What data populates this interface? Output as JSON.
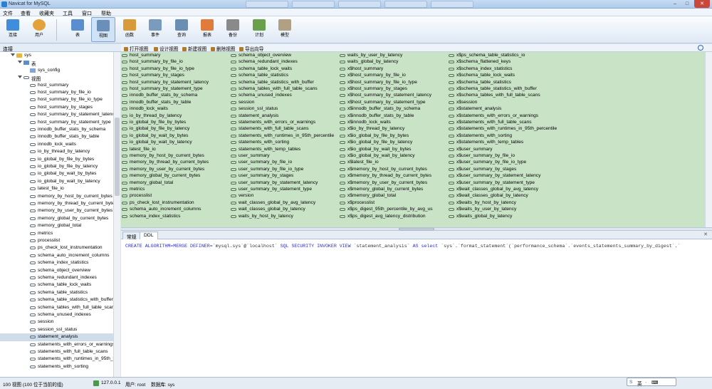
{
  "window": {
    "title": "Navicat for MySQL"
  },
  "menu": [
    "文件",
    "查看",
    "收藏夹",
    "工具",
    "窗口",
    "帮助"
  ],
  "toolbar": [
    {
      "label": "连接",
      "icon": "plug-icon",
      "color": "#3f8ddb"
    },
    {
      "label": "用户",
      "icon": "user-icon",
      "color": "#e4a23a"
    },
    {
      "label": "表",
      "icon": "table-icon",
      "color": "#5b8ecf"
    },
    {
      "label": "视图",
      "icon": "view-icon",
      "color": "#6a8fb8"
    },
    {
      "label": "函数",
      "icon": "function-icon",
      "color": "#d99b3a"
    },
    {
      "label": "事件",
      "icon": "event-icon",
      "color": "#7a9bbd"
    },
    {
      "label": "查询",
      "icon": "query-icon",
      "color": "#6b8fb3"
    },
    {
      "label": "报表",
      "icon": "report-icon",
      "color": "#e07b3c"
    },
    {
      "label": "备份",
      "icon": "backup-icon",
      "color": "#8a8a8a"
    },
    {
      "label": "计划",
      "icon": "schedule-icon",
      "color": "#6aa04c"
    },
    {
      "label": "模型",
      "icon": "model-icon",
      "color": "#b0a184"
    }
  ],
  "left_panel": {
    "title": "连接",
    "tree_top": [
      {
        "label": "sys",
        "level": 0,
        "kind": "db"
      },
      {
        "label": "表",
        "level": 1,
        "kind": "folder"
      },
      {
        "label": "sys_config",
        "level": 2,
        "kind": "table"
      },
      {
        "label": "视图",
        "level": 1,
        "kind": "folder"
      }
    ],
    "views": [
      "host_summary",
      "host_summary_by_file_io",
      "host_summary_by_file_io_type",
      "host_summary_by_stages",
      "host_summary_by_statement_latency",
      "host_summary_by_statement_type",
      "innodb_buffer_stats_by_schema",
      "innodb_buffer_stats_by_table",
      "innodb_lock_waits",
      "io_by_thread_by_latency",
      "io_global_by_file_by_bytes",
      "io_global_by_file_by_latency",
      "io_global_by_wait_by_bytes",
      "io_global_by_wait_by_latency",
      "latest_file_io",
      "memory_by_host_by_current_bytes",
      "memory_by_thread_by_current_bytes",
      "memory_by_user_by_current_bytes",
      "memory_global_by_current_bytes",
      "memory_global_total",
      "metrics",
      "processlist",
      "ps_check_lost_instrumentation",
      "schema_auto_increment_columns",
      "schema_index_statistics",
      "schema_object_overview",
      "schema_redundant_indexes",
      "schema_table_lock_waits",
      "schema_table_statistics",
      "schema_table_statistics_with_buffer",
      "schema_tables_with_full_table_scans",
      "schema_unused_indexes",
      "session",
      "session_ssl_status",
      "statement_analysis",
      "statements_with_errors_or_warnings",
      "statements_with_full_table_scans",
      "statements_with_runtimes_in_95th_percentile",
      "statements_with_sorting"
    ],
    "selected": "statement_analysis"
  },
  "object_toolbar": [
    "打开视图",
    "设计视图",
    "新建视图",
    "删除视图",
    "导出向导"
  ],
  "object_columns": [
    [
      "host_summary",
      "host_summary_by_file_io",
      "host_summary_by_file_io_type",
      "host_summary_by_stages",
      "host_summary_by_statement_latency",
      "host_summary_by_statement_type",
      "innodb_buffer_stats_by_schema",
      "innodb_buffer_stats_by_table",
      "innodb_lock_waits",
      "io_by_thread_by_latency",
      "io_global_by_file_by_bytes",
      "io_global_by_file_by_latency",
      "io_global_by_wait_by_bytes",
      "io_global_by_wait_by_latency",
      "latest_file_io",
      "memory_by_host_by_current_bytes",
      "memory_by_thread_by_current_bytes",
      "memory_by_user_by_current_bytes",
      "memory_global_by_current_bytes",
      "memory_global_total",
      "metrics",
      "processlist",
      "ps_check_lost_instrumentation",
      "schema_auto_increment_columns",
      "schema_index_statistics"
    ],
    [
      "schema_object_overview",
      "schema_redundant_indexes",
      "schema_table_lock_waits",
      "schema_table_statistics",
      "schema_table_statistics_with_buffer",
      "schema_tables_with_full_table_scans",
      "schema_unused_indexes",
      "session",
      "session_ssl_status",
      "statement_analysis",
      "statements_with_errors_or_warnings",
      "statements_with_full_table_scans",
      "statements_with_runtimes_in_95th_percentile",
      "statements_with_sorting",
      "statements_with_temp_tables",
      "user_summary",
      "user_summary_by_file_io",
      "user_summary_by_file_io_type",
      "user_summary_by_stages",
      "user_summary_by_statement_latency",
      "user_summary_by_statement_type",
      "version",
      "wait_classes_global_by_avg_latency",
      "wait_classes_global_by_latency",
      "waits_by_host_by_latency"
    ],
    [
      "waits_by_user_by_latency",
      "waits_global_by_latency",
      "x$host_summary",
      "x$host_summary_by_file_io",
      "x$host_summary_by_file_io_type",
      "x$host_summary_by_stages",
      "x$host_summary_by_statement_latency",
      "x$host_summary_by_statement_type",
      "x$innodb_buffer_stats_by_schema",
      "x$innodb_buffer_stats_by_table",
      "x$innodb_lock_waits",
      "x$io_by_thread_by_latency",
      "x$io_global_by_file_by_bytes",
      "x$io_global_by_file_by_latency",
      "x$io_global_by_wait_by_bytes",
      "x$io_global_by_wait_by_latency",
      "x$latest_file_io",
      "x$memory_by_host_by_current_bytes",
      "x$memory_by_thread_by_current_bytes",
      "x$memory_by_user_by_current_bytes",
      "x$memory_global_by_current_bytes",
      "x$memory_global_total",
      "x$processlist",
      "x$ps_digest_95th_percentile_by_avg_us",
      "x$ps_digest_avg_latency_distribution"
    ],
    [
      "x$ps_schema_table_statistics_io",
      "x$schema_flattened_keys",
      "x$schema_index_statistics",
      "x$schema_table_lock_waits",
      "x$schema_table_statistics",
      "x$schema_table_statistics_with_buffer",
      "x$schema_tables_with_full_table_scans",
      "x$session",
      "x$statement_analysis",
      "x$statements_with_errors_or_warnings",
      "x$statements_with_full_table_scans",
      "x$statements_with_runtimes_in_95th_percentile",
      "x$statements_with_sorting",
      "x$statements_with_temp_tables",
      "x$user_summary",
      "x$user_summary_by_file_io",
      "x$user_summary_by_file_io_type",
      "x$user_summary_by_stages",
      "x$user_summary_by_statement_latency",
      "x$user_summary_by_statement_type",
      "x$wait_classes_global_by_avg_latency",
      "x$wait_classes_global_by_latency",
      "x$waits_by_host_by_latency",
      "x$waits_by_user_by_latency",
      "x$waits_global_by_latency"
    ]
  ],
  "detail_tabs": [
    "常规",
    "DDL"
  ],
  "active_tab": "DDL",
  "ddl": {
    "segments": [
      {
        "text": "CREATE ALGORITHM=MERGE DEFINER=",
        "kw": true
      },
      {
        "text": "`mysql.sys`@`localhost`",
        "kw": false
      },
      {
        "text": " SQL SECURITY INVOKER VIEW ",
        "kw": true
      },
      {
        "text": "`statement_analysis` ",
        "kw": false
      },
      {
        "text": "AS select ",
        "kw": true
      },
      {
        "text": "`sys`.`format_statement`(`performance_schema`.`events_statements_summary_by_digest`.`",
        "kw": false
      }
    ]
  },
  "status": {
    "left": "100 视图 (100 位于当前的组)",
    "host": "127.0.0.1",
    "user": "用户: root",
    "db": "数据库: sys"
  },
  "ime": [
    "S",
    "英",
    "·",
    "⌨"
  ],
  "colors": {
    "grid_bg": "#c9e3c6",
    "selection": "#cfdcea",
    "keyword": "#2c2ccf"
  }
}
